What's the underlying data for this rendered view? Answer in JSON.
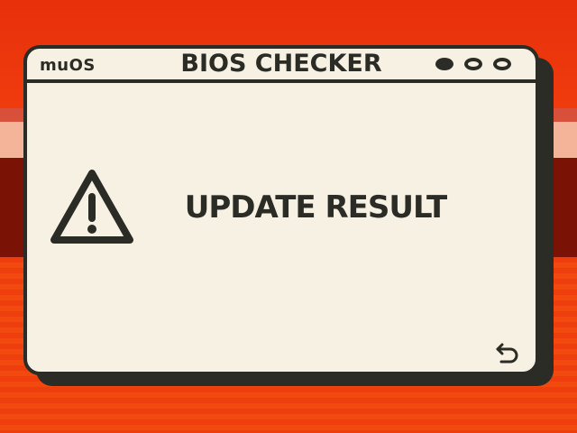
{
  "window": {
    "brand": "muOS",
    "title": "BIOS CHECKER",
    "controls": [
      "minimize-dot",
      "window-dot",
      "close-dot"
    ]
  },
  "content": {
    "icon": "warning-triangle-icon",
    "result_text": "UPDATE RESULT"
  },
  "footer": {
    "back_icon": "back-arrow-icon"
  },
  "colors": {
    "background": "#f23a10",
    "window": "#f6f1e3",
    "ink": "#2c2c26"
  }
}
